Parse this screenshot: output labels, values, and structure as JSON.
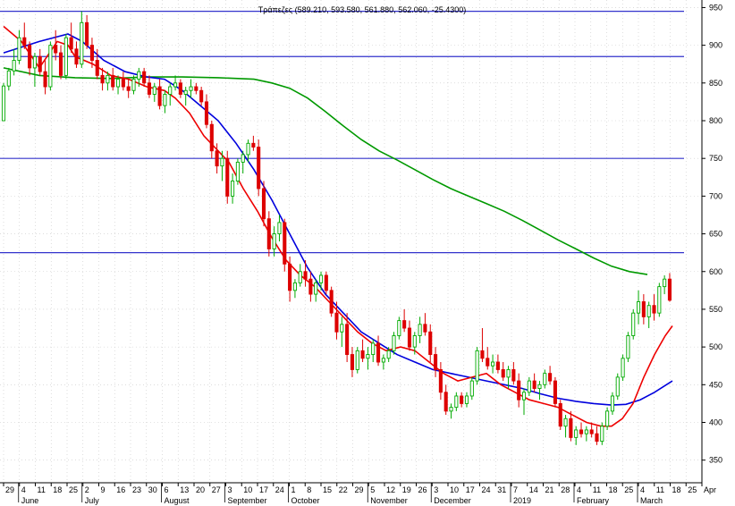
{
  "chart_data": {
    "type": "candlestick",
    "title": "Τράπεζες (589.210, 593.580, 561.880, 562.060, -25.4300)",
    "y_axis": {
      "min": 320,
      "max": 960,
      "ticks": [
        350,
        400,
        450,
        500,
        550,
        600,
        650,
        700,
        750,
        800,
        850,
        900,
        950
      ]
    },
    "x_axis": {
      "day_ticks": [
        "29",
        "4",
        "11",
        "18",
        "25",
        "2",
        "9",
        "16",
        "23",
        "30",
        "6",
        "13",
        "20",
        "27",
        "3",
        "10",
        "17",
        "24",
        "1",
        "8",
        "15",
        "22",
        "29",
        "5",
        "12",
        "19",
        "26",
        "3",
        "10",
        "17",
        "24",
        "31",
        "7",
        "14",
        "21",
        "28",
        "4",
        "11",
        "18",
        "25",
        "4",
        "11",
        "18",
        "25",
        "Apr"
      ],
      "month_labels": [
        "June",
        "July",
        "August",
        "September",
        "October",
        "November",
        "December",
        "2019",
        "February",
        "March"
      ]
    },
    "horizontal_levels": [
      945,
      885,
      750,
      625
    ],
    "colors": {
      "up_candle": "#00aa00",
      "down_candle": "#dd0000",
      "ma_short": "#ee0000",
      "ma_medium": "#0000dd",
      "ma_long": "#009900",
      "level_lines": "#3333cc",
      "grid": "#c8c8c8"
    },
    "ma_short": [
      [
        0,
        925
      ],
      [
        5,
        905
      ],
      [
        10,
        870
      ],
      [
        15,
        905
      ],
      [
        18,
        900
      ],
      [
        20,
        885
      ],
      [
        25,
        875
      ],
      [
        30,
        860
      ],
      [
        35,
        855
      ],
      [
        40,
        845
      ],
      [
        45,
        840
      ],
      [
        48,
        830
      ],
      [
        52,
        810
      ],
      [
        56,
        780
      ],
      [
        60,
        760
      ],
      [
        63,
        745
      ],
      [
        67,
        710
      ],
      [
        71,
        680
      ],
      [
        75,
        645
      ],
      [
        79,
        615
      ],
      [
        83,
        595
      ],
      [
        87,
        580
      ],
      [
        91,
        560
      ],
      [
        95,
        540
      ],
      [
        99,
        520
      ],
      [
        103,
        505
      ],
      [
        107,
        495
      ],
      [
        111,
        500
      ],
      [
        115,
        495
      ],
      [
        119,
        480
      ],
      [
        123,
        465
      ],
      [
        127,
        455
      ],
      [
        131,
        460
      ],
      [
        135,
        465
      ],
      [
        139,
        450
      ],
      [
        143,
        440
      ],
      [
        147,
        430
      ],
      [
        151,
        425
      ],
      [
        155,
        420
      ],
      [
        159,
        410
      ],
      [
        163,
        400
      ],
      [
        167,
        395
      ],
      [
        170,
        395
      ],
      [
        173,
        405
      ],
      [
        176,
        425
      ],
      [
        179,
        460
      ],
      [
        182,
        490
      ],
      [
        185,
        515
      ],
      [
        187,
        528
      ]
    ],
    "ma_medium": [
      [
        0,
        890
      ],
      [
        10,
        905
      ],
      [
        18,
        915
      ],
      [
        22,
        905
      ],
      [
        28,
        880
      ],
      [
        34,
        865
      ],
      [
        40,
        858
      ],
      [
        45,
        855
      ],
      [
        50,
        840
      ],
      [
        55,
        820
      ],
      [
        60,
        800
      ],
      [
        65,
        770
      ],
      [
        70,
        735
      ],
      [
        75,
        695
      ],
      [
        80,
        650
      ],
      [
        85,
        605
      ],
      [
        90,
        570
      ],
      [
        95,
        545
      ],
      [
        100,
        520
      ],
      [
        105,
        505
      ],
      [
        110,
        490
      ],
      [
        115,
        480
      ],
      [
        120,
        470
      ],
      [
        125,
        465
      ],
      [
        130,
        460
      ],
      [
        135,
        455
      ],
      [
        140,
        450
      ],
      [
        145,
        445
      ],
      [
        150,
        438
      ],
      [
        155,
        432
      ],
      [
        160,
        428
      ],
      [
        165,
        425
      ],
      [
        170,
        423
      ],
      [
        174,
        424
      ],
      [
        178,
        430
      ],
      [
        182,
        440
      ],
      [
        187,
        455
      ]
    ],
    "ma_long": [
      [
        0,
        870
      ],
      [
        10,
        860
      ],
      [
        20,
        857
      ],
      [
        30,
        856
      ],
      [
        40,
        858
      ],
      [
        50,
        858
      ],
      [
        60,
        857
      ],
      [
        70,
        855
      ],
      [
        75,
        850
      ],
      [
        80,
        843
      ],
      [
        85,
        830
      ],
      [
        90,
        812
      ],
      [
        95,
        793
      ],
      [
        100,
        775
      ],
      [
        105,
        760
      ],
      [
        110,
        748
      ],
      [
        115,
        735
      ],
      [
        120,
        722
      ],
      [
        125,
        710
      ],
      [
        130,
        700
      ],
      [
        135,
        690
      ],
      [
        140,
        680
      ],
      [
        145,
        668
      ],
      [
        150,
        655
      ],
      [
        155,
        642
      ],
      [
        160,
        630
      ],
      [
        165,
        618
      ],
      [
        170,
        607
      ],
      [
        175,
        600
      ],
      [
        180,
        596
      ]
    ],
    "ohlc": [
      [
        0,
        800,
        850,
        810,
        846
      ],
      [
        1,
        846,
        870,
        840,
        866
      ],
      [
        2,
        866,
        895,
        860,
        880
      ],
      [
        3,
        880,
        920,
        875,
        910
      ],
      [
        4,
        910,
        930,
        895,
        900
      ],
      [
        5,
        900,
        905,
        860,
        870
      ],
      [
        6,
        870,
        890,
        845,
        885
      ],
      [
        7,
        885,
        895,
        860,
        865
      ],
      [
        8,
        865,
        880,
        835,
        845
      ],
      [
        9,
        845,
        905,
        840,
        900
      ],
      [
        10,
        900,
        920,
        880,
        890
      ],
      [
        11,
        890,
        900,
        855,
        860
      ],
      [
        12,
        860,
        915,
        855,
        910
      ],
      [
        13,
        910,
        930,
        890,
        895
      ],
      [
        14,
        895,
        905,
        870,
        875
      ],
      [
        15,
        875,
        945,
        870,
        930
      ],
      [
        16,
        930,
        940,
        895,
        900
      ],
      [
        17,
        900,
        910,
        870,
        880
      ],
      [
        18,
        880,
        895,
        855,
        860
      ],
      [
        19,
        860,
        870,
        840,
        850
      ],
      [
        20,
        850,
        865,
        840,
        860
      ],
      [
        21,
        860,
        870,
        840,
        845
      ],
      [
        22,
        845,
        860,
        835,
        855
      ],
      [
        23,
        855,
        865,
        840,
        845
      ],
      [
        24,
        845,
        855,
        830,
        840
      ],
      [
        25,
        840,
        860,
        835,
        855
      ],
      [
        26,
        855,
        870,
        845,
        865
      ],
      [
        27,
        865,
        870,
        845,
        850
      ],
      [
        28,
        850,
        860,
        830,
        835
      ],
      [
        29,
        835,
        850,
        825,
        845
      ],
      [
        30,
        845,
        855,
        815,
        820
      ],
      [
        31,
        820,
        840,
        810,
        835
      ],
      [
        32,
        835,
        850,
        820,
        845
      ],
      [
        33,
        845,
        860,
        840,
        850
      ],
      [
        34,
        850,
        855,
        830,
        835
      ],
      [
        35,
        835,
        845,
        820,
        840
      ],
      [
        36,
        840,
        855,
        830,
        845
      ],
      [
        37,
        845,
        850,
        835,
        840
      ],
      [
        38,
        840,
        845,
        820,
        825
      ],
      [
        39,
        825,
        835,
        790,
        795
      ],
      [
        40,
        795,
        800,
        750,
        760
      ],
      [
        41,
        760,
        770,
        730,
        740
      ],
      [
        42,
        740,
        760,
        720,
        750
      ],
      [
        43,
        750,
        760,
        690,
        700
      ],
      [
        44,
        700,
        730,
        690,
        720
      ],
      [
        45,
        720,
        750,
        715,
        745
      ],
      [
        46,
        745,
        760,
        730,
        755
      ],
      [
        47,
        755,
        775,
        745,
        770
      ],
      [
        48,
        770,
        780,
        760,
        765
      ],
      [
        49,
        765,
        775,
        700,
        710
      ],
      [
        50,
        710,
        720,
        660,
        670
      ],
      [
        51,
        670,
        680,
        620,
        630
      ],
      [
        52,
        630,
        660,
        620,
        650
      ],
      [
        53,
        650,
        675,
        640,
        665
      ],
      [
        54,
        665,
        670,
        600,
        610
      ],
      [
        55,
        610,
        620,
        560,
        575
      ],
      [
        56,
        575,
        590,
        565,
        585
      ],
      [
        57,
        585,
        610,
        580,
        600
      ],
      [
        58,
        600,
        615,
        580,
        590
      ],
      [
        59,
        590,
        600,
        560,
        570
      ],
      [
        60,
        570,
        590,
        560,
        585
      ],
      [
        61,
        585,
        600,
        575,
        595
      ],
      [
        62,
        595,
        600,
        570,
        575
      ],
      [
        63,
        575,
        580,
        540,
        545
      ],
      [
        64,
        545,
        560,
        510,
        520
      ],
      [
        65,
        520,
        540,
        500,
        530
      ],
      [
        66,
        530,
        545,
        480,
        490
      ],
      [
        67,
        490,
        500,
        460,
        470
      ],
      [
        68,
        470,
        500,
        465,
        495
      ],
      [
        69,
        495,
        510,
        480,
        485
      ],
      [
        70,
        485,
        500,
        470,
        490
      ],
      [
        71,
        490,
        510,
        480,
        505
      ],
      [
        72,
        505,
        515,
        475,
        480
      ],
      [
        73,
        480,
        490,
        470,
        485
      ],
      [
        74,
        485,
        500,
        480,
        495
      ],
      [
        75,
        495,
        520,
        490,
        515
      ],
      [
        76,
        515,
        540,
        510,
        535
      ],
      [
        77,
        535,
        550,
        520,
        525
      ],
      [
        78,
        525,
        535,
        495,
        500
      ],
      [
        79,
        500,
        520,
        490,
        515
      ],
      [
        80,
        515,
        540,
        505,
        530
      ],
      [
        81,
        530,
        545,
        515,
        520
      ],
      [
        82,
        520,
        530,
        480,
        490
      ],
      [
        83,
        490,
        500,
        460,
        470
      ],
      [
        84,
        470,
        480,
        430,
        440
      ],
      [
        85,
        440,
        450,
        410,
        415
      ],
      [
        86,
        415,
        425,
        405,
        420
      ],
      [
        87,
        420,
        440,
        415,
        435
      ],
      [
        88,
        435,
        440,
        420,
        425
      ],
      [
        89,
        425,
        440,
        420,
        435
      ],
      [
        90,
        435,
        460,
        430,
        455
      ],
      [
        91,
        455,
        500,
        450,
        495
      ],
      [
        92,
        495,
        525,
        480,
        485
      ],
      [
        93,
        485,
        500,
        470,
        475
      ],
      [
        94,
        475,
        490,
        465,
        480
      ],
      [
        95,
        480,
        490,
        465,
        470
      ],
      [
        96,
        470,
        480,
        455,
        460
      ],
      [
        97,
        460,
        475,
        445,
        470
      ],
      [
        98,
        470,
        480,
        450,
        455
      ],
      [
        99,
        455,
        465,
        420,
        430
      ],
      [
        100,
        430,
        445,
        410,
        440
      ],
      [
        101,
        440,
        460,
        435,
        455
      ],
      [
        102,
        455,
        465,
        440,
        445
      ],
      [
        103,
        445,
        455,
        430,
        450
      ],
      [
        104,
        450,
        470,
        445,
        465
      ],
      [
        105,
        465,
        475,
        450,
        455
      ],
      [
        106,
        455,
        460,
        420,
        425
      ],
      [
        107,
        425,
        430,
        390,
        395
      ],
      [
        108,
        395,
        410,
        380,
        405
      ],
      [
        109,
        405,
        415,
        375,
        380
      ],
      [
        110,
        380,
        395,
        370,
        390
      ],
      [
        111,
        390,
        400,
        380,
        385
      ],
      [
        112,
        385,
        395,
        375,
        390
      ],
      [
        113,
        390,
        400,
        380,
        385
      ],
      [
        114,
        385,
        395,
        370,
        375
      ],
      [
        115,
        375,
        400,
        370,
        395
      ],
      [
        116,
        395,
        420,
        390,
        415
      ],
      [
        117,
        415,
        440,
        410,
        435
      ],
      [
        118,
        435,
        465,
        430,
        460
      ],
      [
        119,
        460,
        490,
        455,
        485
      ],
      [
        120,
        485,
        520,
        480,
        515
      ],
      [
        121,
        515,
        550,
        510,
        545
      ],
      [
        122,
        545,
        575,
        530,
        560
      ],
      [
        123,
        560,
        570,
        530,
        540
      ],
      [
        124,
        540,
        560,
        525,
        555
      ],
      [
        125,
        555,
        570,
        535,
        545
      ],
      [
        126,
        545,
        585,
        540,
        580
      ],
      [
        127,
        580,
        595,
        570,
        590
      ],
      [
        128,
        590,
        598,
        560,
        562
      ]
    ]
  }
}
